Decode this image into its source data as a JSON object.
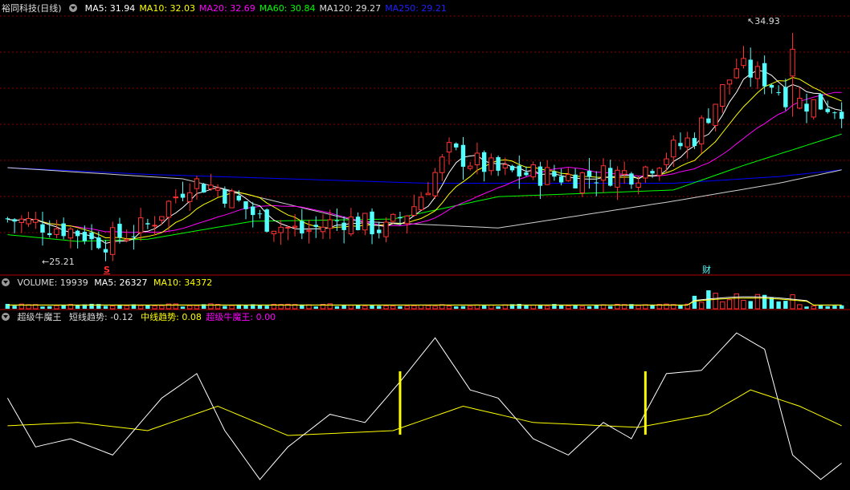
{
  "colors": {
    "up": "#ff3333",
    "down": "#54ffff",
    "ma5": "#ffffff",
    "ma10": "#ffff00",
    "ma20": "#ff00ff",
    "ma60": "#00ff00",
    "ma120": "#ffffff",
    "ma250": "#0000ff",
    "grid": "#8b0000",
    "separator": "#b00000"
  },
  "price_panel": {
    "stock_name": "裕同科技(日线)",
    "ma": [
      {
        "label": "MA5: 31.94",
        "color": "#ffffff"
      },
      {
        "label": "MA10: 32.03",
        "color": "#ffff00"
      },
      {
        "label": "MA20: 32.69",
        "color": "#ff00ff"
      },
      {
        "label": "MA60: 30.84",
        "color": "#00ff00"
      },
      {
        "label": "MA120: 29.27",
        "color": "#dddddd"
      },
      {
        "label": "MA250: 29.21",
        "color": "#2020ff"
      }
    ],
    "high_label": "34.93",
    "low_label": "25.21",
    "marker_s": "S",
    "marker_cai": "财"
  },
  "volume_panel": {
    "name": "VOLUME: 19939",
    "ma5": "MA5: 26327",
    "ma10": "MA10: 34372"
  },
  "indicator_panel": {
    "name": "超级牛魔王",
    "short": "短线趋势: -0.12",
    "mid": "中线趋势: 0.08",
    "king": "超级牛魔王: 0.00"
  },
  "chart_data": {
    "type": "candlestick",
    "price_range": [
      24.2,
      35.9
    ],
    "high": 34.93,
    "low": 25.21,
    "candle_count": 120,
    "ma_lines": [
      "MA5",
      "MA10",
      "MA20",
      "MA60",
      "MA120",
      "MA250"
    ],
    "ma250_points": [
      [
        0,
        28.9
      ],
      [
        20,
        28.6
      ],
      [
        60,
        28.2
      ],
      [
        95,
        28.2
      ],
      [
        110,
        28.5
      ],
      [
        119,
        28.8
      ]
    ],
    "ma120_points": [
      [
        0,
        28.9
      ],
      [
        25,
        28.4
      ],
      [
        50,
        26.5
      ],
      [
        70,
        26.2
      ],
      [
        95,
        27.4
      ],
      [
        110,
        28.2
      ],
      [
        119,
        28.8
      ]
    ],
    "ma60_points": [
      [
        0,
        25.9
      ],
      [
        10,
        25.6
      ],
      [
        20,
        25.7
      ],
      [
        35,
        26.5
      ],
      [
        55,
        26.6
      ],
      [
        70,
        27.6
      ],
      [
        95,
        27.9
      ],
      [
        105,
        29.0
      ],
      [
        119,
        30.4
      ]
    ],
    "indicator_short": [
      [
        0,
        0.55
      ],
      [
        4,
        0.25
      ],
      [
        9,
        0.3
      ],
      [
        15,
        0.2
      ],
      [
        22,
        0.55
      ],
      [
        27,
        0.7
      ],
      [
        31,
        0.35
      ],
      [
        36,
        0.05
      ],
      [
        40,
        0.25
      ],
      [
        46,
        0.45
      ],
      [
        51,
        0.4
      ],
      [
        56,
        0.65
      ],
      [
        61,
        0.92
      ],
      [
        66,
        0.6
      ],
      [
        70,
        0.55
      ],
      [
        75,
        0.3
      ],
      [
        80,
        0.2
      ],
      [
        85,
        0.4
      ],
      [
        89,
        0.3
      ],
      [
        94,
        0.7
      ],
      [
        99,
        0.72
      ],
      [
        104,
        0.95
      ],
      [
        108,
        0.85
      ],
      [
        112,
        0.2
      ],
      [
        116,
        0.05
      ],
      [
        119,
        0.15
      ]
    ],
    "indicator_mid": [
      [
        0,
        0.38
      ],
      [
        10,
        0.4
      ],
      [
        20,
        0.35
      ],
      [
        30,
        0.5
      ],
      [
        40,
        0.32
      ],
      [
        55,
        0.35
      ],
      [
        65,
        0.5
      ],
      [
        75,
        0.4
      ],
      [
        90,
        0.37
      ],
      [
        100,
        0.45
      ],
      [
        106,
        0.6
      ],
      [
        113,
        0.5
      ],
      [
        119,
        0.38
      ]
    ],
    "signals": [
      56,
      91
    ]
  }
}
